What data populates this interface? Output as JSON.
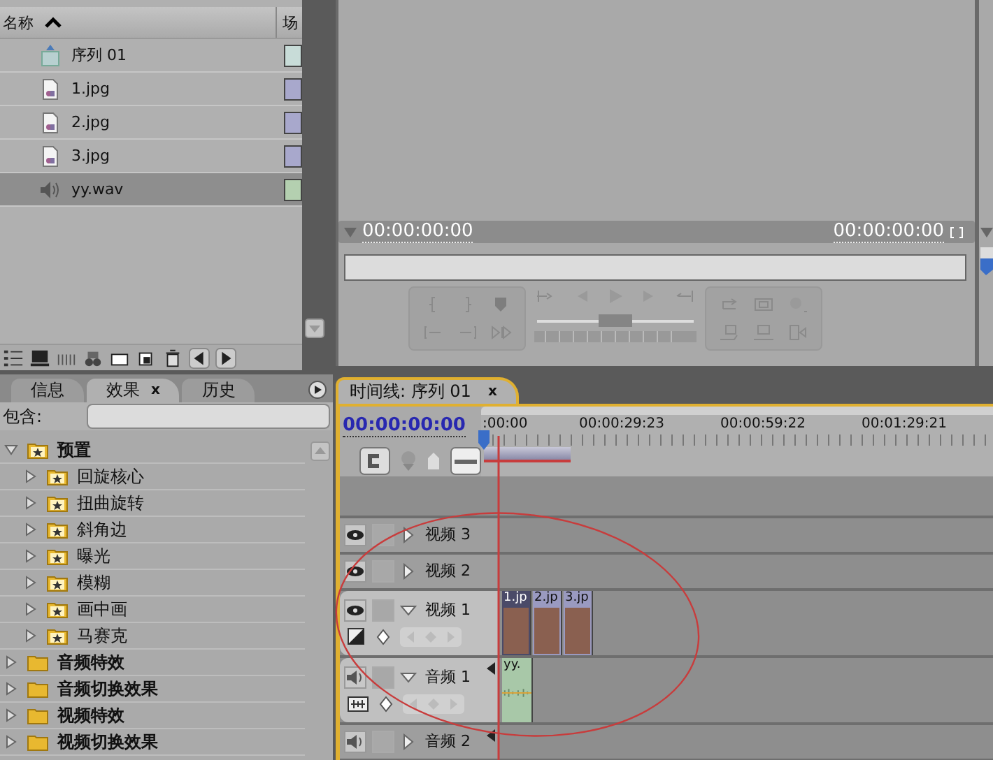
{
  "project": {
    "columns": [
      {
        "label": "名称",
        "sorted_ascending": true
      },
      {
        "label": "场"
      }
    ],
    "items": [
      {
        "name": "序列 01",
        "kind": "sequence",
        "selected": false,
        "color": "#c8dcd8"
      },
      {
        "name": "1.jpg",
        "kind": "image",
        "selected": false,
        "color": "#a8a8cc"
      },
      {
        "name": "2.jpg",
        "kind": "image",
        "selected": false,
        "color": "#a8a8cc"
      },
      {
        "name": "3.jpg",
        "kind": "image",
        "selected": false,
        "color": "#a8a8cc"
      },
      {
        "name": "yy.wav",
        "kind": "audio",
        "selected": true,
        "color": "#b4d0b0"
      }
    ]
  },
  "monitor": {
    "timecode_in": "00:00:00:00",
    "timecode_out": "00:00:00:00",
    "shuttle": {
      "level": 0.5
    }
  },
  "effects_panel": {
    "tabs": [
      {
        "label": "信息",
        "selected": false,
        "closable": false
      },
      {
        "label": "效果",
        "selected": true,
        "closable": true
      },
      {
        "label": "历史",
        "selected": false,
        "closable": false
      }
    ],
    "close_glyph": "x",
    "search_label": "包含:",
    "tree": [
      {
        "label": "预置",
        "kind": "preset",
        "expanded": true,
        "children": [
          {
            "label": "回旋核心",
            "kind": "preset",
            "expanded": false
          },
          {
            "label": "扭曲旋转",
            "kind": "preset",
            "expanded": false
          },
          {
            "label": "斜角边",
            "kind": "preset",
            "expanded": false
          },
          {
            "label": "曝光",
            "kind": "preset",
            "expanded": false
          },
          {
            "label": "模糊",
            "kind": "preset",
            "expanded": false
          },
          {
            "label": "画中画",
            "kind": "preset",
            "expanded": false
          },
          {
            "label": "马赛克",
            "kind": "preset",
            "expanded": false
          }
        ]
      },
      {
        "label": "音频特效",
        "kind": "folder",
        "expanded": false
      },
      {
        "label": "音频切换效果",
        "kind": "folder",
        "expanded": false
      },
      {
        "label": "视频特效",
        "kind": "folder",
        "expanded": false
      },
      {
        "label": "视频切换效果",
        "kind": "folder",
        "expanded": false
      }
    ]
  },
  "timeline": {
    "tab": "时间线: 序列 01",
    "close_glyph": "x",
    "timecode": "00:00:00:00",
    "ruler": [
      ":00:00",
      "00:00:29:23",
      "00:00:59:22",
      "00:01:29:21"
    ],
    "tracks": [
      {
        "kind": "video",
        "name": "视频 3",
        "expanded": false
      },
      {
        "kind": "video",
        "name": "视频 2",
        "expanded": false
      },
      {
        "kind": "video",
        "name": "视频 1",
        "expanded": true,
        "clips": [
          {
            "label": "1.jp",
            "selected": true
          },
          {
            "label": "2.jp",
            "selected": false
          },
          {
            "label": "3.jp",
            "selected": false
          }
        ]
      },
      {
        "kind": "audio",
        "name": "音频 1",
        "expanded": true,
        "clips": [
          {
            "label": "yy.",
            "selected": false
          }
        ]
      },
      {
        "kind": "audio",
        "name": "音频 2",
        "expanded": false
      }
    ]
  }
}
